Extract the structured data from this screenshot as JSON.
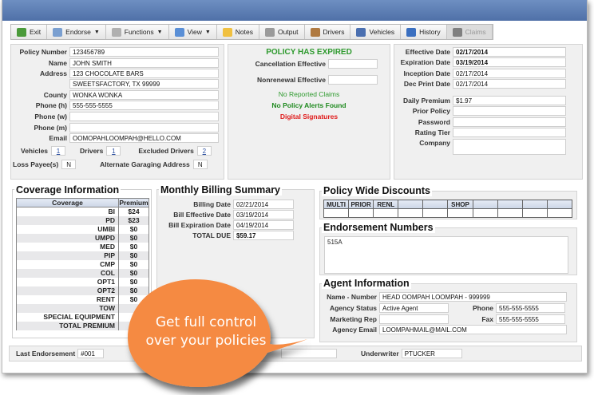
{
  "toolbar": {
    "buttons": [
      {
        "label": "Exit",
        "icon": "exit-door-icon",
        "color": "#4a9a3a",
        "dropdown": false,
        "disabled": false
      },
      {
        "label": "Endorse",
        "icon": "wrench-icon",
        "color": "#7a9fd0",
        "dropdown": true,
        "disabled": false
      },
      {
        "label": "Functions",
        "icon": "gear-icon",
        "color": "#b0b0b0",
        "dropdown": true,
        "disabled": false
      },
      {
        "label": "View",
        "icon": "window-icon",
        "color": "#5a8fd6",
        "dropdown": true,
        "disabled": false
      },
      {
        "label": "Notes",
        "icon": "note-icon",
        "color": "#f0c040",
        "dropdown": false,
        "disabled": false
      },
      {
        "label": "Output",
        "icon": "printer-icon",
        "color": "#9a9a9a",
        "dropdown": false,
        "disabled": false
      },
      {
        "label": "Drivers",
        "icon": "person-icon",
        "color": "#b07a40",
        "dropdown": false,
        "disabled": false
      },
      {
        "label": "Vehicles",
        "icon": "car-icon",
        "color": "#4a6fb0",
        "dropdown": false,
        "disabled": false
      },
      {
        "label": "History",
        "icon": "book-icon",
        "color": "#3a6fc0",
        "dropdown": false,
        "disabled": false
      },
      {
        "label": "Claims",
        "icon": "binoculars-icon",
        "color": "#808080",
        "dropdown": false,
        "disabled": true
      }
    ]
  },
  "policyholder": {
    "policy_number": {
      "label": "Policy Number",
      "value": "123456789"
    },
    "name": {
      "label": "Name",
      "value": "JOHN SMITH"
    },
    "address": {
      "label": "Address",
      "line1": "123 CHOCOLATE BARS",
      "line2": "SWEETSFACTORY, TX 99999"
    },
    "county": {
      "label": "County",
      "value": "WONKA WONKA"
    },
    "phone_h": {
      "label": "Phone (h)",
      "value": "555-555-5555"
    },
    "phone_w": {
      "label": "Phone (w)",
      "value": ""
    },
    "phone_m": {
      "label": "Phone (m)",
      "value": ""
    },
    "email": {
      "label": "Email",
      "value": "OOMOPAHLOOMPAH@HELLO.COM"
    },
    "vehicles": {
      "label": "Vehicles",
      "value": "1"
    },
    "drivers": {
      "label": "Drivers",
      "value": "1"
    },
    "excluded_drivers": {
      "label": "Excluded Drivers",
      "value": "2"
    },
    "loss_payee": {
      "label": "Loss Payee(s)",
      "value": "N"
    },
    "alt_garaging": {
      "label": "Alternate Garaging Address",
      "value": "N"
    }
  },
  "status": {
    "headline": "POLICY HAS EXPIRED",
    "cancellation": {
      "label": "Cancellation Effective",
      "value": ""
    },
    "nonrenewal": {
      "label": "Nonrenewal Effective",
      "value": ""
    },
    "claims": "No Reported Claims",
    "alerts": "No Policy Alerts Found",
    "signatures": "Digital Signatures",
    "colors": {
      "green": "#2e9a2e",
      "red": "#e01b1b"
    }
  },
  "dates": {
    "effective": {
      "label": "Effective Date",
      "value": "02/17/2014"
    },
    "expiration": {
      "label": "Expiration Date",
      "value": "03/19/2014"
    },
    "inception": {
      "label": "Inception Date",
      "value": "02/17/2014"
    },
    "dec_print": {
      "label": "Dec Print Date",
      "value": "02/17/2014"
    },
    "daily_premium": {
      "label": "Daily Premium",
      "value": "$1.97"
    },
    "prior_policy": {
      "label": "Prior Policy",
      "value": ""
    },
    "password": {
      "label": "Password",
      "value": ""
    },
    "rating_tier": {
      "label": "Rating Tier",
      "value": ""
    },
    "company": {
      "label": "Company",
      "value": ""
    }
  },
  "coverage": {
    "title": "Coverage Information",
    "headers": [
      "Coverage",
      "Premium"
    ],
    "rows": [
      {
        "name": "BI",
        "premium": "$24"
      },
      {
        "name": "PD",
        "premium": "$23"
      },
      {
        "name": "UMBI",
        "premium": "$0"
      },
      {
        "name": "UMPD",
        "premium": "$0"
      },
      {
        "name": "MED",
        "premium": "$0"
      },
      {
        "name": "PIP",
        "premium": "$0"
      },
      {
        "name": "CMP",
        "premium": "$0"
      },
      {
        "name": "COL",
        "premium": "$0"
      },
      {
        "name": "OPT1",
        "premium": "$0"
      },
      {
        "name": "OPT2",
        "premium": "$0"
      },
      {
        "name": "RENT",
        "premium": "$0"
      },
      {
        "name": "TOW",
        "premium": ""
      },
      {
        "name": "SPECIAL EQUIPMENT",
        "premium": ""
      },
      {
        "name": "TOTAL PREMIUM",
        "premium": "$"
      }
    ]
  },
  "billing": {
    "title": "Monthly Billing Summary",
    "billing_date": {
      "label": "Billing Date",
      "value": "02/21/2014"
    },
    "bill_effective": {
      "label": "Bill Effective Date",
      "value": "03/19/2014"
    },
    "bill_expiration": {
      "label": "Bill Expiration Date",
      "value": "04/19/2014"
    },
    "total_due": {
      "label": "TOTAL DUE",
      "value": "$59.17"
    }
  },
  "discounts": {
    "title": "Policy Wide Discounts",
    "headers": [
      "MULTI",
      "PRIOR",
      "RENL",
      "",
      "",
      "SHOP",
      "",
      "",
      "",
      ""
    ]
  },
  "endorsements": {
    "title": "Endorsement Numbers",
    "value": "515A"
  },
  "agent": {
    "title": "Agent Information",
    "name_number": {
      "label": "Name - Number",
      "value": "HEAD OOMPAH LOOMPAH - 999999"
    },
    "agency_status": {
      "label": "Agency Status",
      "value": "Active Agent"
    },
    "phone": {
      "label": "Phone",
      "value": "555-555-5555"
    },
    "marketing_rep": {
      "label": "Marketing Rep",
      "value": ""
    },
    "fax": {
      "label": "Fax",
      "value": "555-555-5555"
    },
    "agency_email": {
      "label": "Agency Email",
      "value": "LOOMPAHMAIL@MAIL.COM"
    }
  },
  "footer": {
    "last_endorsement": {
      "label": "Last Endorsement",
      "value": "#001"
    },
    "underwriter": {
      "label": "Underwriter",
      "value": "PTUCKER"
    }
  },
  "callout": {
    "line1": "Get full control",
    "line2": "over your policies",
    "color": "#f58a42"
  }
}
